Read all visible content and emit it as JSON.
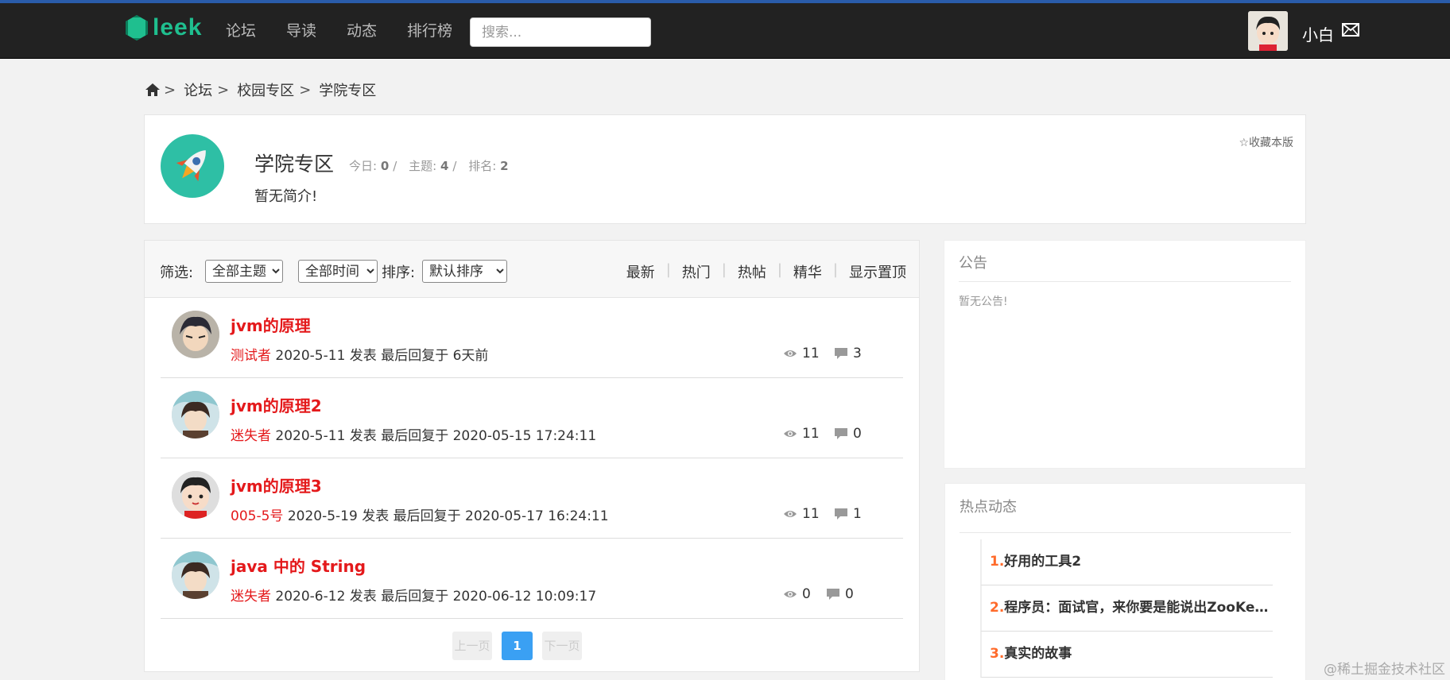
{
  "brand": {
    "logo_text": "leek",
    "accent": "#1fbf8f"
  },
  "nav": {
    "items": [
      "论坛",
      "导读",
      "动态",
      "排行榜"
    ]
  },
  "search": {
    "placeholder": "搜索..."
  },
  "user": {
    "name": "小白"
  },
  "breadcrumb": {
    "items": [
      "论坛",
      "校园专区",
      "学院专区"
    ],
    "separator": ">"
  },
  "forum": {
    "title": "学院专区",
    "stats": {
      "today_label": "今日:",
      "today": "0",
      "topics_label": "主题:",
      "topics": "4",
      "rank_label": "排名:",
      "rank": "2",
      "divider": "/"
    },
    "description": "暂无简介!",
    "favorite_label": "☆收藏本版"
  },
  "filters": {
    "filter_label": "筛选:",
    "topic_select": {
      "value": "全部主题"
    },
    "time_select": {
      "value": "全部时间"
    },
    "sort_label": "排序:",
    "sort_select": {
      "value": "默认排序"
    },
    "sort_links": [
      "最新",
      "热门",
      "热帖",
      "精华",
      "显示置顶"
    ]
  },
  "threads": [
    {
      "title": "jvm的原理",
      "author": "测试者",
      "posted": "2020-5-11 发表",
      "last_reply": "最后回复于 6天前",
      "views": "11",
      "replies": "3",
      "avatar": "dark-hair-boy"
    },
    {
      "title": "jvm的原理2",
      "author": "迷失者",
      "posted": "2020-5-11 发表",
      "last_reply": "最后回复于 2020-05-15 17:24:11",
      "views": "11",
      "replies": "0",
      "avatar": "anime-boy"
    },
    {
      "title": "jvm的原理3",
      "author": "005-5号",
      "posted": "2020-5-19 发表",
      "last_reply": "最后回复于 2020-05-17 16:24:11",
      "views": "11",
      "replies": "1",
      "avatar": "cartoon-boy"
    },
    {
      "title": "java 中的 String",
      "author": "迷失者",
      "posted": "2020-6-12 发表",
      "last_reply": "最后回复于 2020-06-12 10:09:17",
      "views": "0",
      "replies": "0",
      "avatar": "anime-boy"
    }
  ],
  "pagination": {
    "prev": "上一页",
    "current": "1",
    "next": "下一页"
  },
  "notice": {
    "title": "公告",
    "body": "暂无公告!"
  },
  "hot": {
    "title": "热点动态",
    "items": [
      {
        "num": "1.",
        "text": "好用的工具2"
      },
      {
        "num": "2.",
        "text": "程序员：面试官，来你要是能说出ZooKeeper原理"
      },
      {
        "num": "3.",
        "text": "真实的故事"
      }
    ]
  },
  "watermark": "@稀土掘金技术社区"
}
